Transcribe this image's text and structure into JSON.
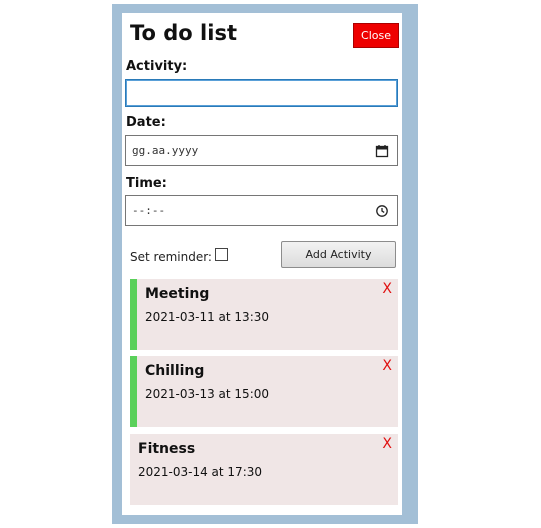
{
  "app": {
    "title": "To do list",
    "close_label": "Close"
  },
  "form": {
    "activity_label": "Activity:",
    "activity_value": "",
    "date_label": "Date:",
    "date_placeholder": "gg.aa.yyyy",
    "time_label": "Time:",
    "time_placeholder": "--:--",
    "reminder_label": "Set reminder:",
    "reminder_checked": false,
    "add_label": "Add Activity"
  },
  "activities": [
    {
      "title": "Meeting",
      "when": "2021-03-11 at 13:30",
      "reminder": true,
      "delete_label": "X"
    },
    {
      "title": "Chilling",
      "when": "2021-03-13 at 15:00",
      "reminder": true,
      "delete_label": "X"
    },
    {
      "title": "Fitness",
      "when": "2021-03-14 at 17:30",
      "reminder": false,
      "delete_label": "X"
    }
  ],
  "colors": {
    "frame": "#a3bfd6",
    "close_button": "#ee0000",
    "reminder_accent": "#5ad05a",
    "card_background": "#f0e6e6",
    "delete_x": "#e01010"
  },
  "icons": {
    "date": "calendar-icon",
    "time": "clock-icon"
  }
}
